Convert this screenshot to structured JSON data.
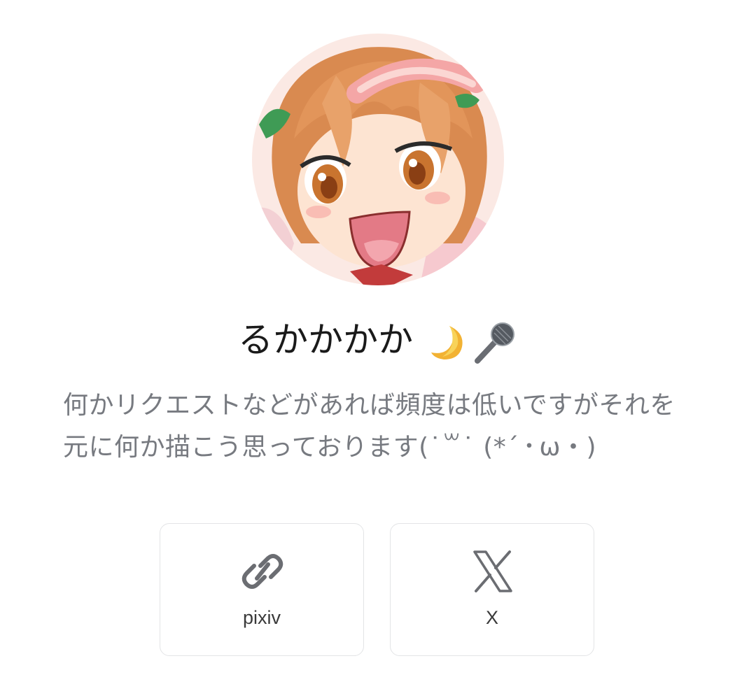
{
  "profile": {
    "name": "るかかかか",
    "name_emojis": [
      "crescent-moon-icon",
      "microphone-icon"
    ],
    "bio_lines": [
      "何かリクエストなどがあれば頻度は低いですがそれを",
      "元に何か描こう思っております(˙꒳˙ (*´・ω・)"
    ]
  },
  "links": [
    {
      "label": "pixiv",
      "icon": "link-icon"
    },
    {
      "label": "X",
      "icon": "x-logo-icon"
    }
  ],
  "colors": {
    "background": "#ffffff",
    "name_text": "#1a1a1a",
    "bio_text": "#777a80",
    "card_border": "#e3e4e6",
    "icon_gray": "#6b6d72"
  }
}
